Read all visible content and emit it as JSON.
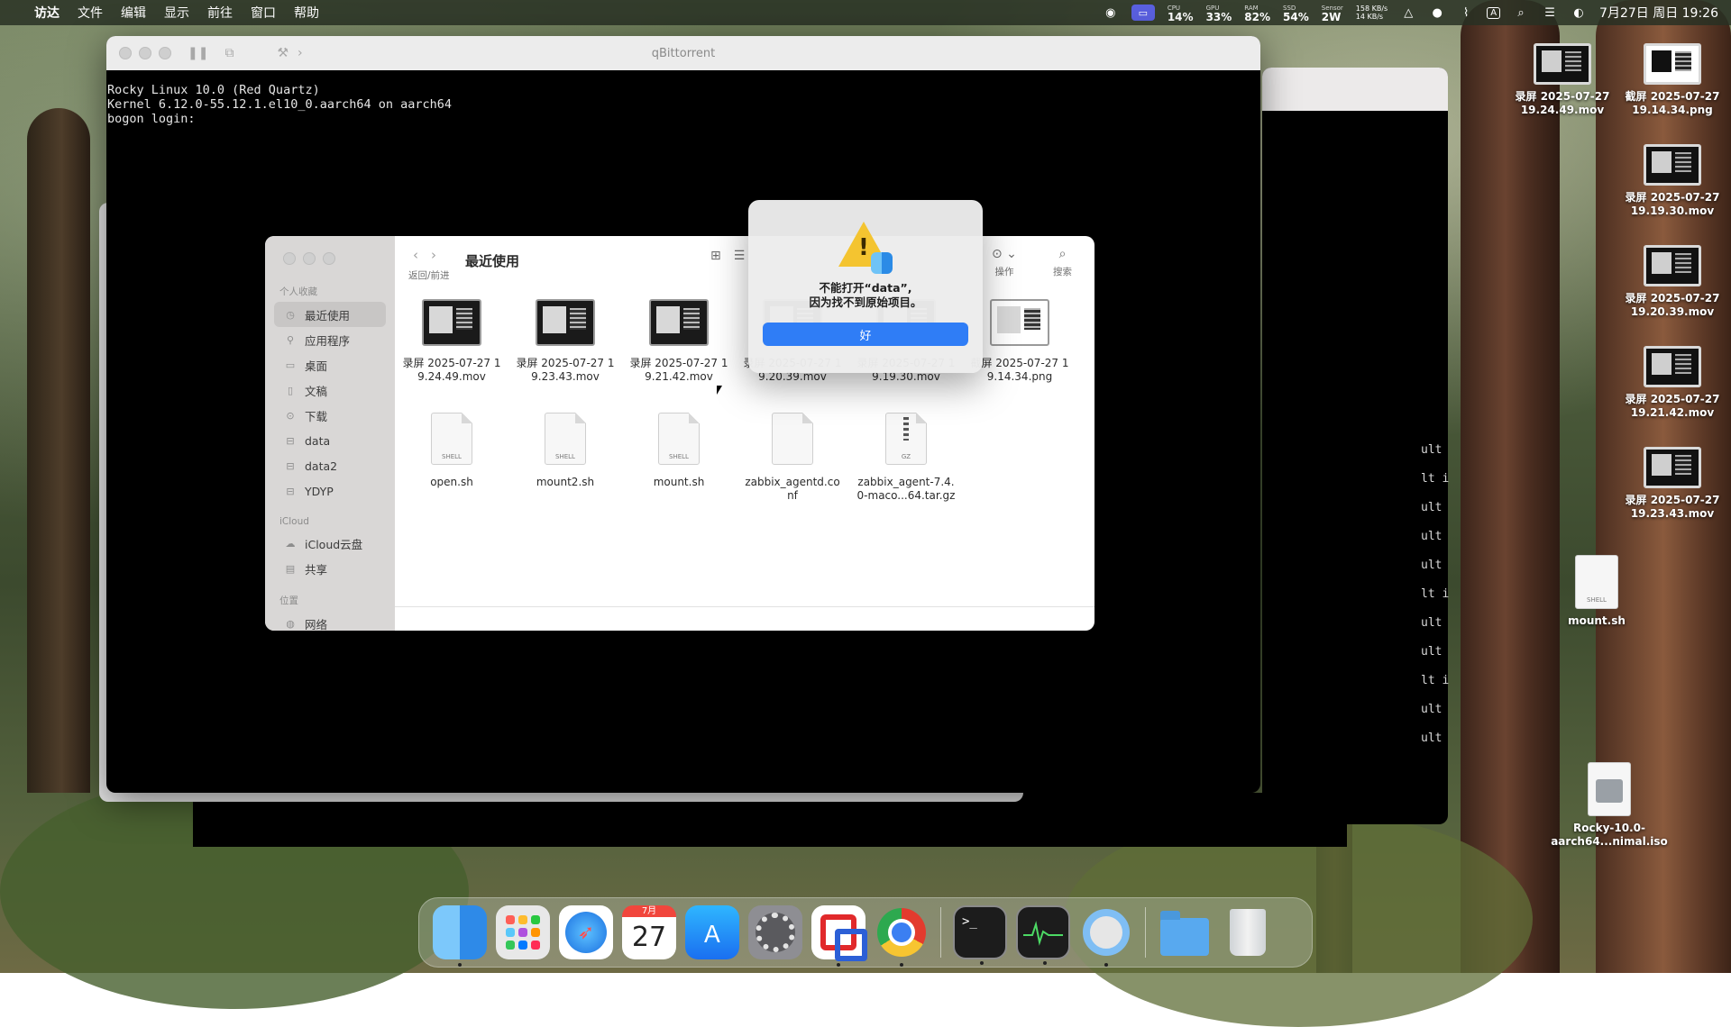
{
  "menubar": {
    "items": [
      "访达",
      "文件",
      "编辑",
      "显示",
      "前往",
      "窗口",
      "帮助"
    ],
    "stats": [
      {
        "label": "CPU",
        "value": "14%"
      },
      {
        "label": "GPU",
        "value": "33%"
      },
      {
        "label": "RAM",
        "value": "82%"
      },
      {
        "label": "SSD",
        "value": "54%"
      },
      {
        "label": "Sensor",
        "value": "2W"
      }
    ],
    "net_up": "158 KB/s",
    "net_down": "14 KB/s",
    "input_method": "A",
    "clock": "7月27日 周日  19:26"
  },
  "terminal_window": {
    "title": "qBittorrent",
    "lines": [
      "Rocky Linux 10.0 (Red Quartz)",
      "Kernel 6.12.0-55.12.1.el10_0.aarch64 on aarch64",
      "",
      "bogon login:"
    ],
    "fragments": [
      "ult",
      "lt i",
      "ult",
      "ult",
      "ult",
      "lt i",
      "ult",
      "ult",
      "lt i",
      "ult",
      "ult"
    ]
  },
  "finder": {
    "title": "最近使用",
    "nav_label": "返回/前进",
    "action_label": "操作",
    "search_label": "搜索",
    "sidebar": {
      "section_favorites": "个人收藏",
      "favorites": [
        {
          "label": "最近使用",
          "icon": "clock-icon",
          "active": true
        },
        {
          "label": "应用程序",
          "icon": "apps-icon"
        },
        {
          "label": "桌面",
          "icon": "desktop-icon"
        },
        {
          "label": "文稿",
          "icon": "document-icon"
        },
        {
          "label": "下载",
          "icon": "download-icon"
        },
        {
          "label": "data",
          "icon": "drive-icon"
        },
        {
          "label": "data2",
          "icon": "drive-icon"
        },
        {
          "label": "YDYP",
          "icon": "drive-icon"
        }
      ],
      "section_icloud": "iCloud",
      "icloud": [
        {
          "label": "iCloud云盘",
          "icon": "cloud-icon"
        },
        {
          "label": "共享",
          "icon": "shared-folder-icon"
        }
      ],
      "section_locations": "位置",
      "locations": [
        {
          "label": "网络",
          "icon": "network-icon"
        }
      ]
    },
    "files": [
      {
        "name": "录屏 2025-07-27 19.24.49.mov",
        "kind": "video"
      },
      {
        "name": "录屏 2025-07-27 19.23.43.mov",
        "kind": "video"
      },
      {
        "name": "录屏 2025-07-27 19.21.42.mov",
        "kind": "video"
      },
      {
        "name": "录屏 2025-07-27 19.20.39.mov",
        "kind": "video"
      },
      {
        "name": "录屏 2025-07-27 19.19.30.mov",
        "kind": "video"
      },
      {
        "name": "截屏 2025-07-27 19.14.34.png",
        "kind": "image"
      },
      {
        "name": "open.sh",
        "kind": "shell",
        "tag": "SHELL"
      },
      {
        "name": "mount2.sh",
        "kind": "shell",
        "tag": "SHELL"
      },
      {
        "name": "mount.sh",
        "kind": "shell",
        "tag": "SHELL"
      },
      {
        "name": "zabbix_agentd.conf",
        "kind": "text"
      },
      {
        "name": "zabbix_agent-7.4.0-maco...64.tar.gz",
        "kind": "archive",
        "tag": "GZ"
      }
    ]
  },
  "alert": {
    "line1": "不能打开“data”,",
    "line2": "因为找不到原始项目。",
    "ok_label": "好"
  },
  "desktop": {
    "items": [
      {
        "name": "录屏 2025-07-27 19.24.49.mov",
        "kind": "video"
      },
      {
        "name": "截屏 2025-07-27 19.14.34.png",
        "kind": "image"
      },
      {
        "name": "录屏 2025-07-27 19.19.30.mov",
        "kind": "video"
      },
      {
        "name": "录屏 2025-07-27 19.20.39.mov",
        "kind": "video"
      },
      {
        "name": "录屏 2025-07-27 19.21.42.mov",
        "kind": "video"
      },
      {
        "name": "录屏 2025-07-27 19.23.43.mov",
        "kind": "video"
      },
      {
        "name": "mount.sh",
        "kind": "shell",
        "tag": "SHELL"
      },
      {
        "name": "Rocky-10.0-aarch64...nimal.iso",
        "kind": "iso"
      }
    ]
  },
  "dock": {
    "apps": [
      "Finder",
      "Launchpad",
      "Safari",
      "Calendar",
      "App Store",
      "System Settings",
      "Parallels Desktop",
      "Google Chrome",
      "Terminal",
      "Activity Monitor",
      "QuickTime Player",
      "Downloads",
      "Trash"
    ],
    "calendar_month": "7月",
    "calendar_day": "27",
    "terminal_prompt": ">_"
  }
}
